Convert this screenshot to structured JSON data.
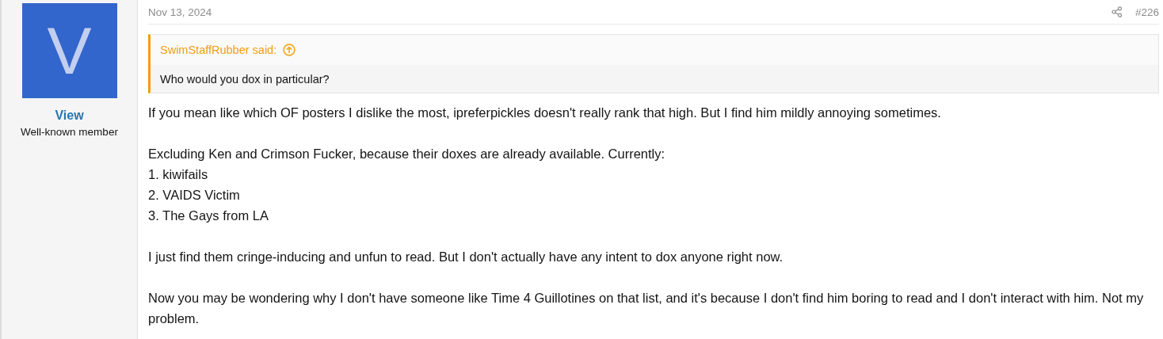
{
  "post": {
    "date": "Nov 13, 2024",
    "number": "#226",
    "author": {
      "avatar_letter": "V",
      "name": "View",
      "role": "Well-known member"
    },
    "quote": {
      "attribution": "SwimStaffRubber said:",
      "text": "Who would you dox in particular?"
    },
    "paragraphs": [
      "If you mean like which OF posters I dislike the most, ipreferpickles doesn't really rank that high. But I find him mildly annoying sometimes.",
      "Excluding Ken and Crimson Fucker, because their doxes are already available. Currently:\n1. kiwifails\n2. VAIDS Victim\n3. The Gays from LA",
      "I just find them cringe-inducing and unfun to read. But I don't actually have any intent to dox anyone right now.",
      "Now you may be wondering why I don't have someone like Time 4 Guillotines on that list, and it's because I don't find him boring to read and I don't interact with him. Not my problem."
    ]
  }
}
